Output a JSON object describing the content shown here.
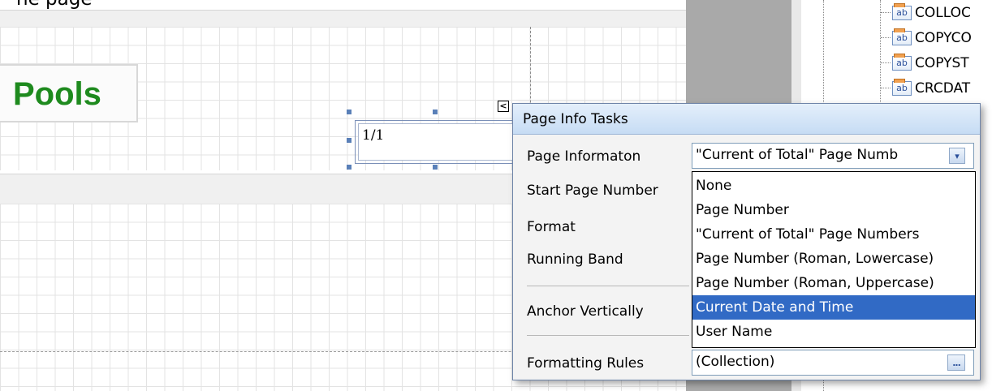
{
  "designer": {
    "top_text": "ne page",
    "title_text": "Pools",
    "page_info_text": "1/1"
  },
  "tree": {
    "items": [
      {
        "icon": "ab",
        "label": "COLLOC"
      },
      {
        "icon": "ab",
        "label": "COPYCO"
      },
      {
        "icon": "ab",
        "label": "COPYST"
      },
      {
        "icon": "ab",
        "label": "CRCDAT"
      }
    ]
  },
  "panel": {
    "header": "Page Info Tasks",
    "collapse_glyph": "<",
    "labels": {
      "page_information": "Page Informaton",
      "start_page_number": "Start Page Number",
      "format": "Format",
      "running_band": "Running Band",
      "anchor_vertically": "Anchor Vertically",
      "formatting_rules": "Formatting Rules"
    },
    "page_information_value": "\"Current of Total\" Page Numb",
    "formatting_rules_value": "(Collection)",
    "ellipsis_label": "...",
    "dropdown_arrow": "▾"
  },
  "dropdown": {
    "options": [
      "None",
      "Page Number",
      "\"Current of Total\" Page Numbers",
      "Page Number (Roman, Lowercase)",
      "Page Number (Roman, Uppercase)",
      "Current Date and Time",
      "User Name"
    ],
    "selected": "Current Date and Time"
  },
  "colors": {
    "title_green": "#1e8a1e",
    "selection_blue": "#316ac5",
    "header_blue": "#c6dcf4"
  }
}
